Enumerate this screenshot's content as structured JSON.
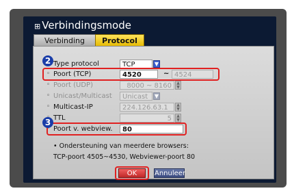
{
  "dialog": {
    "title": "Verbindingsmode",
    "tabs": [
      {
        "label": "Verbinding",
        "active": false
      },
      {
        "label": "Protocol",
        "active": true
      }
    ]
  },
  "rows": {
    "type_protocol": {
      "label": "Type protocol",
      "value": "TCP"
    },
    "poort_tcp": {
      "label": "Poort (TCP)",
      "value": "4520",
      "range_end": "4524"
    },
    "poort_udp": {
      "label": "Poort (UDP)",
      "value": "8000 ~ 8160"
    },
    "unicast_multicast": {
      "label": "Unicast/Multicast",
      "value": "Unicast"
    },
    "multicast_ip": {
      "label": "Multicast-IP",
      "value": "224.126.63.1"
    },
    "ttl": {
      "label": "TTL",
      "value": "5"
    },
    "poort_webview": {
      "label": "Poort v. webview.",
      "value": "80"
    }
  },
  "info": {
    "line1": "• Ondersteuning van meerdere browsers:",
    "line2": "TCP-poort 4505~4530, Webviewer-poort 80"
  },
  "buttons": {
    "ok": "OK",
    "cancel": "Annuleer"
  },
  "callouts": {
    "step2": "2",
    "step3": "3"
  },
  "icons": {
    "title_icon": "network-icon",
    "dropdown": "chevron-down-icon",
    "spinner": "up-down-arrows-icon"
  },
  "colors": {
    "active_tab": "#f2c400",
    "highlight": "#e02020",
    "callout_badge": "#1a3da8",
    "ok_button": "#d83a3a",
    "cancel_button": "#4a5a90"
  }
}
